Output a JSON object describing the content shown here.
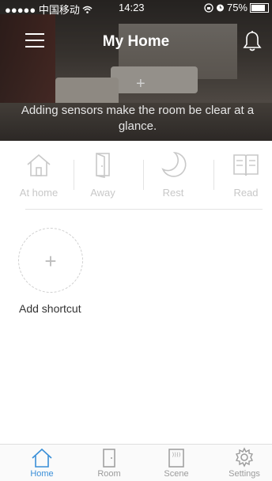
{
  "status_bar": {
    "carrier": "●●●●● 中国移动 ",
    "time": "14:23",
    "battery": "75%"
  },
  "header": {
    "title": "My Home",
    "menu_icon": "hamburger-menu-icon",
    "notification_icon": "bell-icon"
  },
  "hero": {
    "message": "Adding sensors make the room be clear at a glance."
  },
  "modes": [
    {
      "label": "At home",
      "icon": "house-icon"
    },
    {
      "label": "Away",
      "icon": "door-icon"
    },
    {
      "label": "Rest",
      "icon": "moon-icon"
    },
    {
      "label": "Read",
      "icon": "book-icon"
    }
  ],
  "shortcut": {
    "add_label": "Add shortcut"
  },
  "tabs": [
    {
      "label": "Home",
      "icon": "home-icon",
      "active": true
    },
    {
      "label": "Room",
      "icon": "room-door-icon",
      "active": false
    },
    {
      "label": "Scene",
      "icon": "scene-icon",
      "active": false
    },
    {
      "label": "Settings",
      "icon": "gear-icon",
      "active": false
    }
  ],
  "colors": {
    "accent": "#3a8fd8",
    "inactive": "#9b9b9b",
    "mode_icon": "#c8c8c8"
  }
}
